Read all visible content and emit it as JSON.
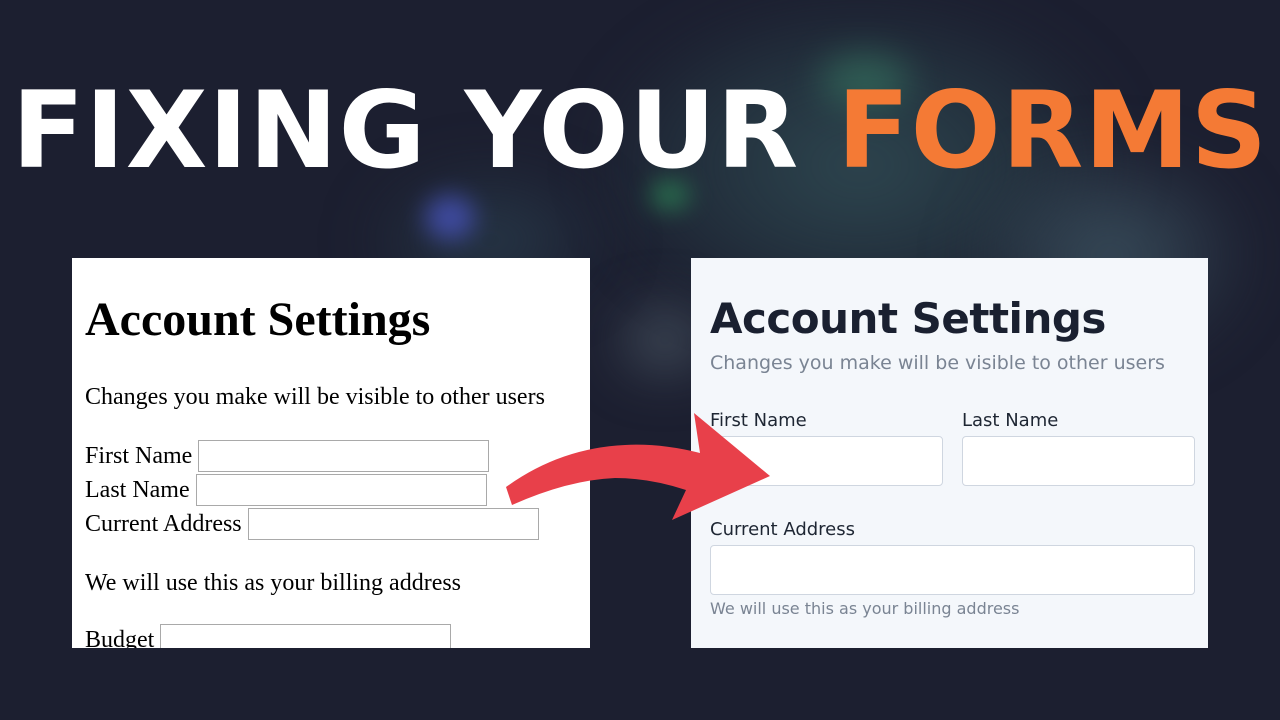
{
  "headline": {
    "text_white": "FIXING YOUR",
    "text_accent": "FORMS",
    "accent_color": "#f47a35"
  },
  "before_form": {
    "title": "Account Settings",
    "subtitle": "Changes you make will be visible to other users",
    "first_name_label": "First Name",
    "last_name_label": "Last Name",
    "address_label": "Current Address",
    "address_note": "We will use this as your billing address",
    "budget_label": "Budget"
  },
  "after_form": {
    "title": "Account Settings",
    "subtitle": "Changes you make will be visible to other users",
    "first_name_label": "First Name",
    "last_name_label": "Last Name",
    "address_label": "Current Address",
    "address_hint": "We will use this as your billing address"
  },
  "arrow": {
    "color": "#e8404a",
    "icon": "curved-arrow-right-icon"
  }
}
